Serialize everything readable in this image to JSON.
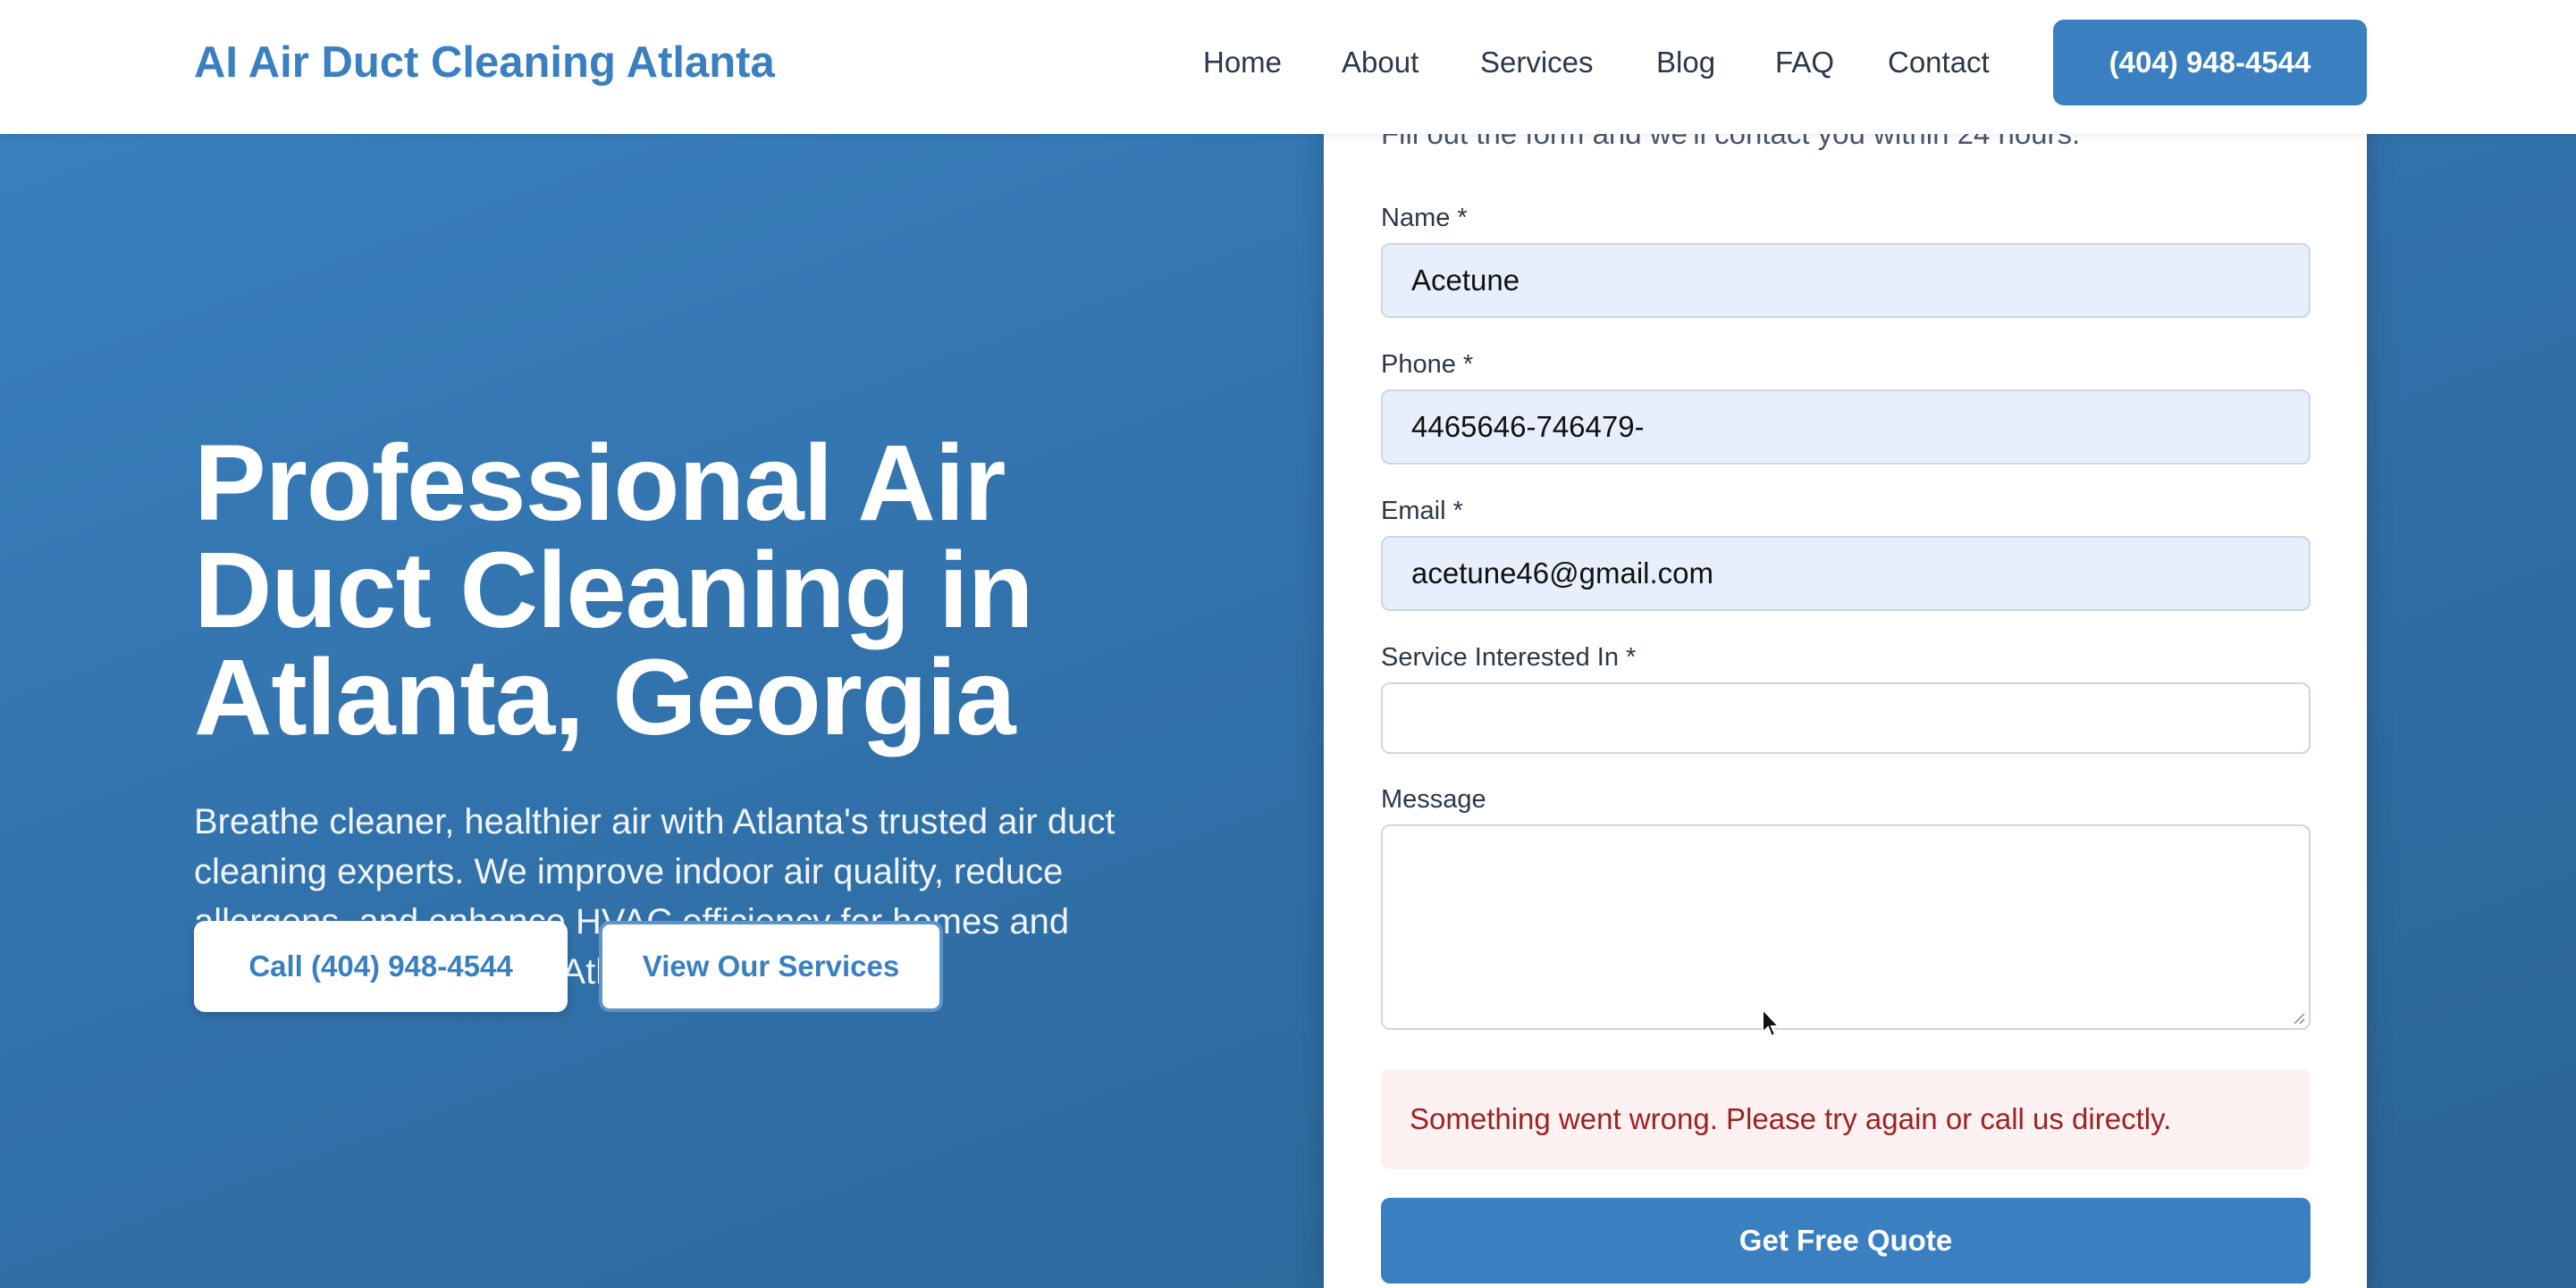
{
  "header": {
    "brand": "AI Air Duct Cleaning Atlanta",
    "nav": [
      "Home",
      "About",
      "Services",
      "Blog",
      "FAQ",
      "Contact"
    ],
    "phone_button": "(404) 948-4544"
  },
  "hero": {
    "title": "Professional Air Duct Cleaning in Atlanta, Georgia",
    "description": "Breathe cleaner, healthier air with Atlanta's trusted air duct cleaning experts. We improve indoor air quality, reduce allergens, and enhance HVAC efficiency for homes and businesses throughout Atlanta.",
    "call_button": "Call (404) 948-4544",
    "services_button": "View Our Services"
  },
  "form": {
    "subtitle": "Fill out the form and we'll contact you within 24 hours.",
    "name_label": "Name *",
    "name_value": "Acetune",
    "phone_label": "Phone *",
    "phone_value": "4465646-746479-",
    "email_label": "Email *",
    "email_value": "acetune46@gmail.com",
    "service_label": "Service Interested In *",
    "service_value": "",
    "message_label": "Message",
    "message_value": "",
    "error": "Something went wrong. Please try again or call us directly.",
    "submit": "Get Free Quote"
  },
  "colors": {
    "brand": "#3a80c1",
    "hero_bg": "#3171aa",
    "error_text": "#9b2323",
    "error_bg": "#fdf1f1",
    "filled_field_bg": "#e8effc"
  }
}
